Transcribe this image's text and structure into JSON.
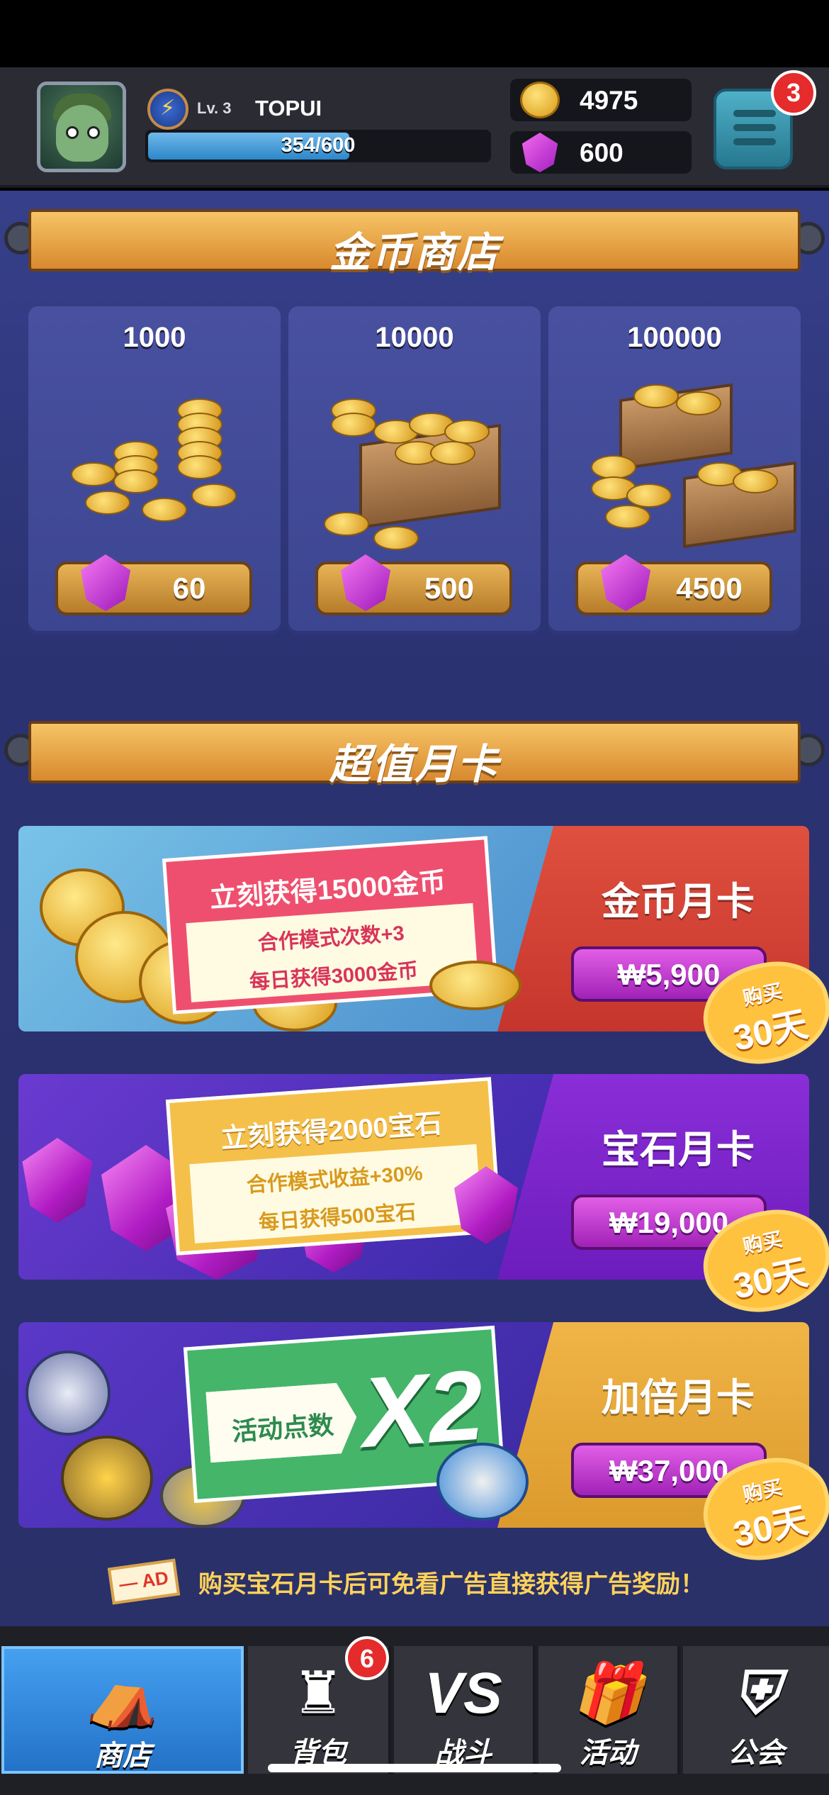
{
  "header": {
    "level": "Lv. 3",
    "player_name": "TOPUI",
    "xp_text": "354/600",
    "xp_progress": 0.59,
    "gold": "4975",
    "gems": "600",
    "menu_badge": "3",
    "icons": {
      "avatar": "goblin-soldier-avatar",
      "level": "lightning-badge-icon",
      "gold": "coin-icon",
      "gems": "gem-icon",
      "menu": "list-menu-icon"
    }
  },
  "gold_shop": {
    "title": "金币商店",
    "items": [
      {
        "amount": "1000",
        "price": "60"
      },
      {
        "amount": "10000",
        "price": "500"
      },
      {
        "amount": "100000",
        "price": "4500"
      }
    ]
  },
  "monthly": {
    "title": "超值月卡",
    "cards": [
      {
        "name": "金币月卡",
        "price": "₩5,900",
        "ticket_head": "立刻获得15000金币",
        "ticket_line1": "合作模式次数+3",
        "ticket_line2": "每日获得3000金币",
        "sticker_top": "购买",
        "sticker_bottom": "30天"
      },
      {
        "name": "宝石月卡",
        "price": "₩19,000",
        "ticket_head": "立刻获得2000宝石",
        "ticket_line1": "合作模式收益+30%",
        "ticket_line2": "每日获得500宝石",
        "sticker_top": "购买",
        "sticker_bottom": "30天"
      },
      {
        "name": "加倍月卡",
        "price": "₩37,000",
        "ticket_label": "活动点数",
        "ticket_multiplier": "X2",
        "sticker_top": "购买",
        "sticker_bottom": "30天"
      }
    ],
    "ad_tag": "— AD",
    "ad_note": "购买宝石月卡后可免看广告直接获得广告奖励！"
  },
  "nav": {
    "items": [
      {
        "label": "商店",
        "icon": "shop-icon",
        "active": true
      },
      {
        "label": "背包",
        "icon": "backpack-rook-icon",
        "badge": "6"
      },
      {
        "label": "战斗",
        "icon": "VS"
      },
      {
        "label": "活动",
        "icon": "gift-icon"
      },
      {
        "label": "公会",
        "icon": "guild-shield-icon"
      }
    ]
  },
  "colors": {
    "accent_blue": "#2d87c9",
    "banner_gold": "#d9892e",
    "gem_purple": "#a01cbf",
    "gold_card_red": "#d84237",
    "gem_card_purple": "#7a22c8",
    "boost_card_orange": "#e6a63a",
    "badge_red": "#e52b2b"
  }
}
